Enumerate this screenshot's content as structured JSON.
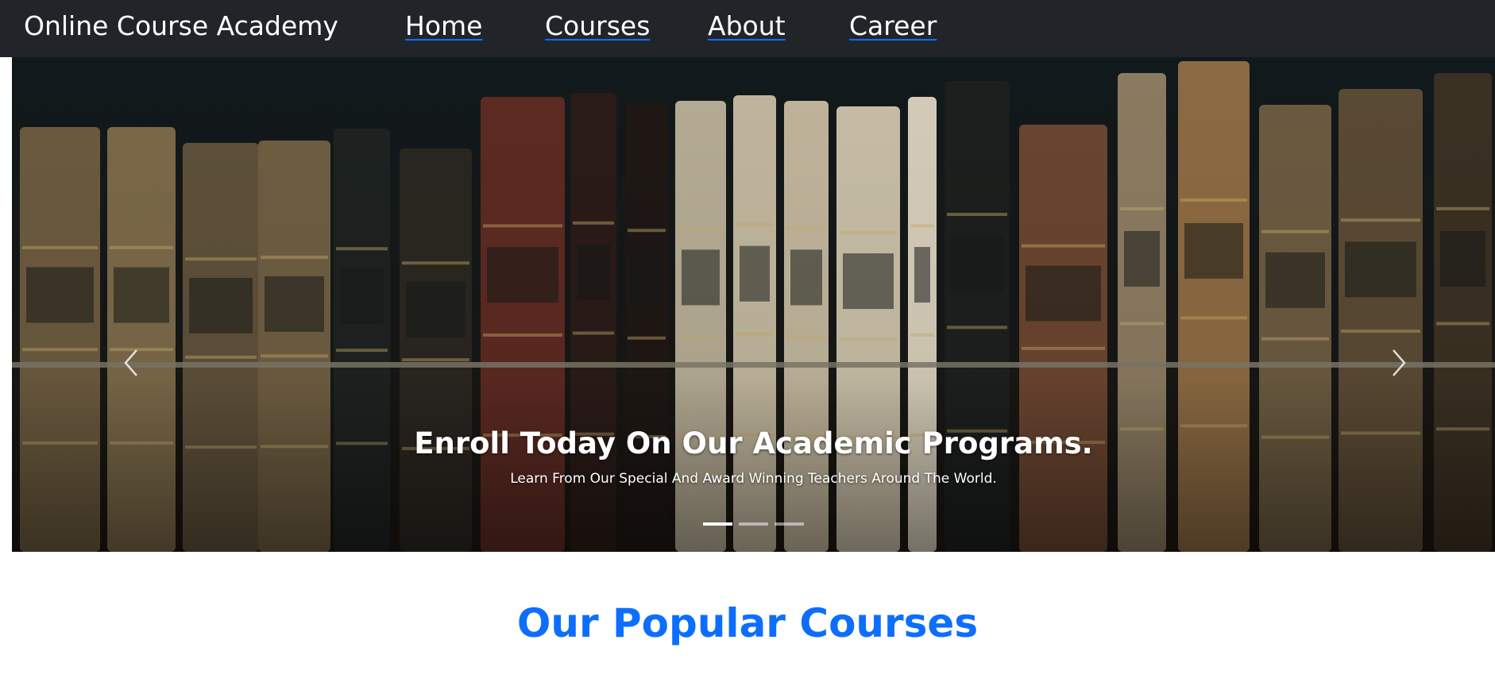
{
  "navbar": {
    "brand": "Online Course Academy",
    "links": [
      "Home",
      "Courses",
      "About",
      "Career"
    ]
  },
  "carousel": {
    "caption_title": "Enroll Today On Our Academic Programs.",
    "caption_text": "Learn From Our Special And Award Winning Teachers Around The World.",
    "active_slide": 1,
    "slide_count": 3
  },
  "section": {
    "title": "Our Popular Courses"
  },
  "colors": {
    "navbar_bg": "#212529",
    "accent": "#0d6efd",
    "nav_text": "#ffffff"
  },
  "icons": {
    "prev": "chevron-left-icon",
    "next": "chevron-right-icon"
  }
}
